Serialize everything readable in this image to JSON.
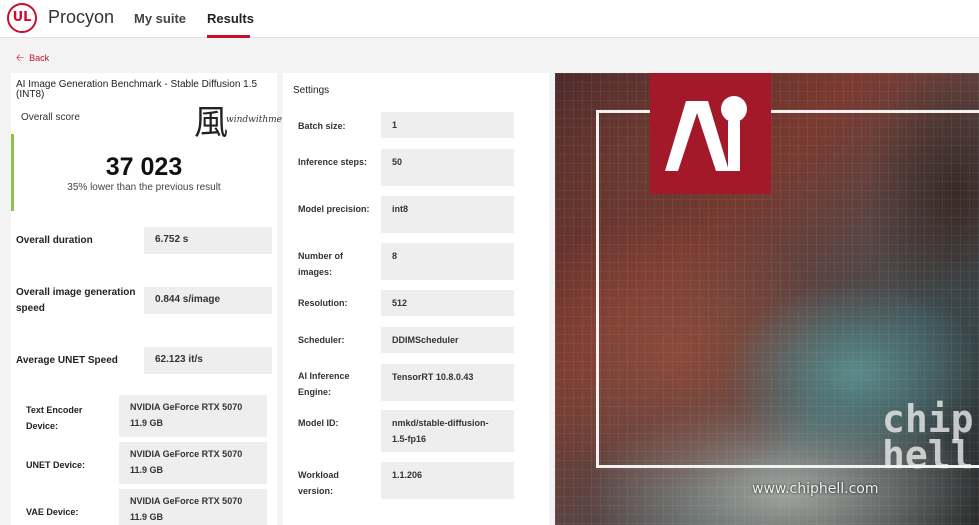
{
  "header": {
    "logo_text": "UL",
    "app_name": "Procyon",
    "nav": {
      "my_suite": "My suite",
      "results": "Results"
    },
    "accent_color": "#c8102e"
  },
  "back": {
    "icon": "arrow-left-icon",
    "label": "Back"
  },
  "result": {
    "benchmark_title": "AI Image Generation Benchmark - Stable Diffusion 1.5 (INT8)",
    "overall_score_label": "Overall score",
    "score": "37 023",
    "comparison": "35% lower than the previous result",
    "score_indicator_color": "#8bc34a",
    "metrics": [
      {
        "label": "Overall duration",
        "value": "6.752 s"
      },
      {
        "label": "Overall image generation speed",
        "value": "0.844 s/image"
      },
      {
        "label": "Average UNET Speed",
        "value": "62.123 it/s"
      }
    ],
    "devices": [
      {
        "label": "Text Encoder Device:",
        "value": "NVIDIA GeForce RTX 5070 11.9 GB"
      },
      {
        "label": "UNET Device:",
        "value": "NVIDIA GeForce RTX 5070 11.9 GB"
      },
      {
        "label": "VAE Device:",
        "value": "NVIDIA GeForce RTX 5070 11.9 GB"
      }
    ]
  },
  "watermark": {
    "char": "風",
    "signature": "windwithme"
  },
  "settings": {
    "title": "Settings",
    "rows": [
      {
        "label": "Batch size:",
        "value": "1"
      },
      {
        "label": "Inference steps:",
        "value": "50"
      },
      {
        "label": "Model precision:",
        "value": "int8"
      },
      {
        "label": "Number of images:",
        "value": "8"
      },
      {
        "label": "Resolution:",
        "value": "512"
      },
      {
        "label": "Scheduler:",
        "value": "DDIMScheduler"
      },
      {
        "label": "AI Inference Engine:",
        "value": "TensorRT 10.8.0.43"
      },
      {
        "label": "Model ID:",
        "value": "nmkd/stable-diffusion-1.5-fp16"
      },
      {
        "label": "Workload version:",
        "value": "1.1.206"
      }
    ]
  },
  "artwork": {
    "badge_text": "AI",
    "badge_color": "#a3192a",
    "site_watermark": "www.chiphell.com",
    "chip_watermark": "chip hell"
  }
}
